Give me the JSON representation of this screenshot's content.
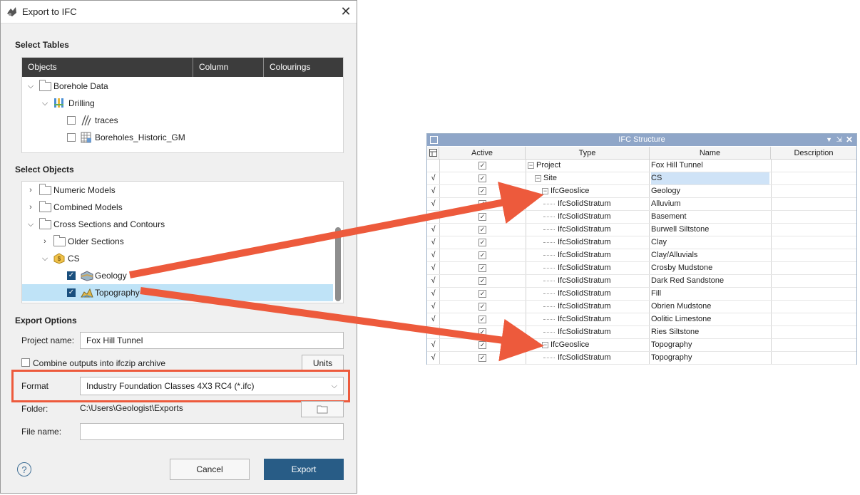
{
  "dialog": {
    "title": "Export to IFC",
    "close_label": "✕"
  },
  "select_tables": {
    "heading": "Select Tables",
    "columns": [
      "Objects",
      "Column",
      "Colourings"
    ],
    "rows": [
      {
        "label": "Borehole Data",
        "type": "folder",
        "expanded": true
      },
      {
        "label": "Drilling",
        "type": "drilling",
        "expanded": true
      },
      {
        "label": "traces",
        "type": "traces",
        "checked": false
      },
      {
        "label": "Boreholes_Historic_GM",
        "type": "table",
        "checked": false
      }
    ]
  },
  "select_objects": {
    "heading": "Select Objects",
    "rows": [
      {
        "label": "Numeric Models",
        "type": "folder",
        "expanded": false
      },
      {
        "label": "Combined Models",
        "type": "folder",
        "expanded": false
      },
      {
        "label": "Cross Sections and Contours",
        "type": "folder",
        "expanded": true
      },
      {
        "label": "Older Sections",
        "type": "folder",
        "expanded": false
      },
      {
        "label": "CS",
        "type": "cross-section",
        "expanded": true
      },
      {
        "label": "Geology",
        "type": "geology",
        "checked": true
      },
      {
        "label": "Topography",
        "type": "topography",
        "checked": true,
        "selected": true
      }
    ]
  },
  "export_options": {
    "heading": "Export Options",
    "project_name_label": "Project name:",
    "project_name_value": "Fox Hill Tunnel",
    "combine_label": "Combine outputs into ifczip archive",
    "units_label": "Units",
    "format_label": "Format",
    "format_value": "Industry Foundation Classes 4X3 RC4 (*.ifc)",
    "folder_label": "Folder:",
    "folder_value": "C:\\Users\\Geologist\\Exports",
    "file_name_label": "File name:",
    "file_name_value": ""
  },
  "footer": {
    "help_label": "?",
    "cancel_label": "Cancel",
    "export_label": "Export"
  },
  "ifc_structure": {
    "title": "IFC Structure",
    "columns": [
      "Active",
      "Type",
      "Name",
      "Description"
    ],
    "rows": [
      {
        "mark": "",
        "type": "Project",
        "name": "Fox Hill Tunnel",
        "level": 0
      },
      {
        "mark": "√",
        "type": "Site",
        "name": "CS",
        "level": 1
      },
      {
        "mark": "√",
        "type": "IfcGeoslice",
        "name": "Geology",
        "level": 2
      },
      {
        "mark": "√",
        "type": "IfcSolidStratum",
        "name": "Alluvium",
        "level": 3
      },
      {
        "mark": "√",
        "type": "IfcSolidStratum",
        "name": "Basement",
        "level": 3
      },
      {
        "mark": "√",
        "type": "IfcSolidStratum",
        "name": "Burwell Siltstone",
        "level": 3
      },
      {
        "mark": "√",
        "type": "IfcSolidStratum",
        "name": "Clay",
        "level": 3
      },
      {
        "mark": "√",
        "type": "IfcSolidStratum",
        "name": "Clay/Alluvials",
        "level": 3
      },
      {
        "mark": "√",
        "type": "IfcSolidStratum",
        "name": "Crosby Mudstone",
        "level": 3
      },
      {
        "mark": "√",
        "type": "IfcSolidStratum",
        "name": "Dark Red Sandstone",
        "level": 3
      },
      {
        "mark": "√",
        "type": "IfcSolidStratum",
        "name": "Fill",
        "level": 3
      },
      {
        "mark": "√",
        "type": "IfcSolidStratum",
        "name": "Obrien Mudstone",
        "level": 3
      },
      {
        "mark": "√",
        "type": "IfcSolidStratum",
        "name": "Oolitic Limestone",
        "level": 3
      },
      {
        "mark": "√",
        "type": "IfcSolidStratum",
        "name": "Ries Siltstone",
        "level": 3
      },
      {
        "mark": "√",
        "type": "IfcGeoslice",
        "name": "Topography",
        "level": 2
      },
      {
        "mark": "√",
        "type": "IfcSolidStratum",
        "name": "Topography",
        "level": 3
      }
    ]
  },
  "colors": {
    "highlight": "#ed5a3c",
    "selected_row": "#bfe3f7",
    "ifc_header": "#8fa6c8",
    "primary_button": "#285c86"
  }
}
